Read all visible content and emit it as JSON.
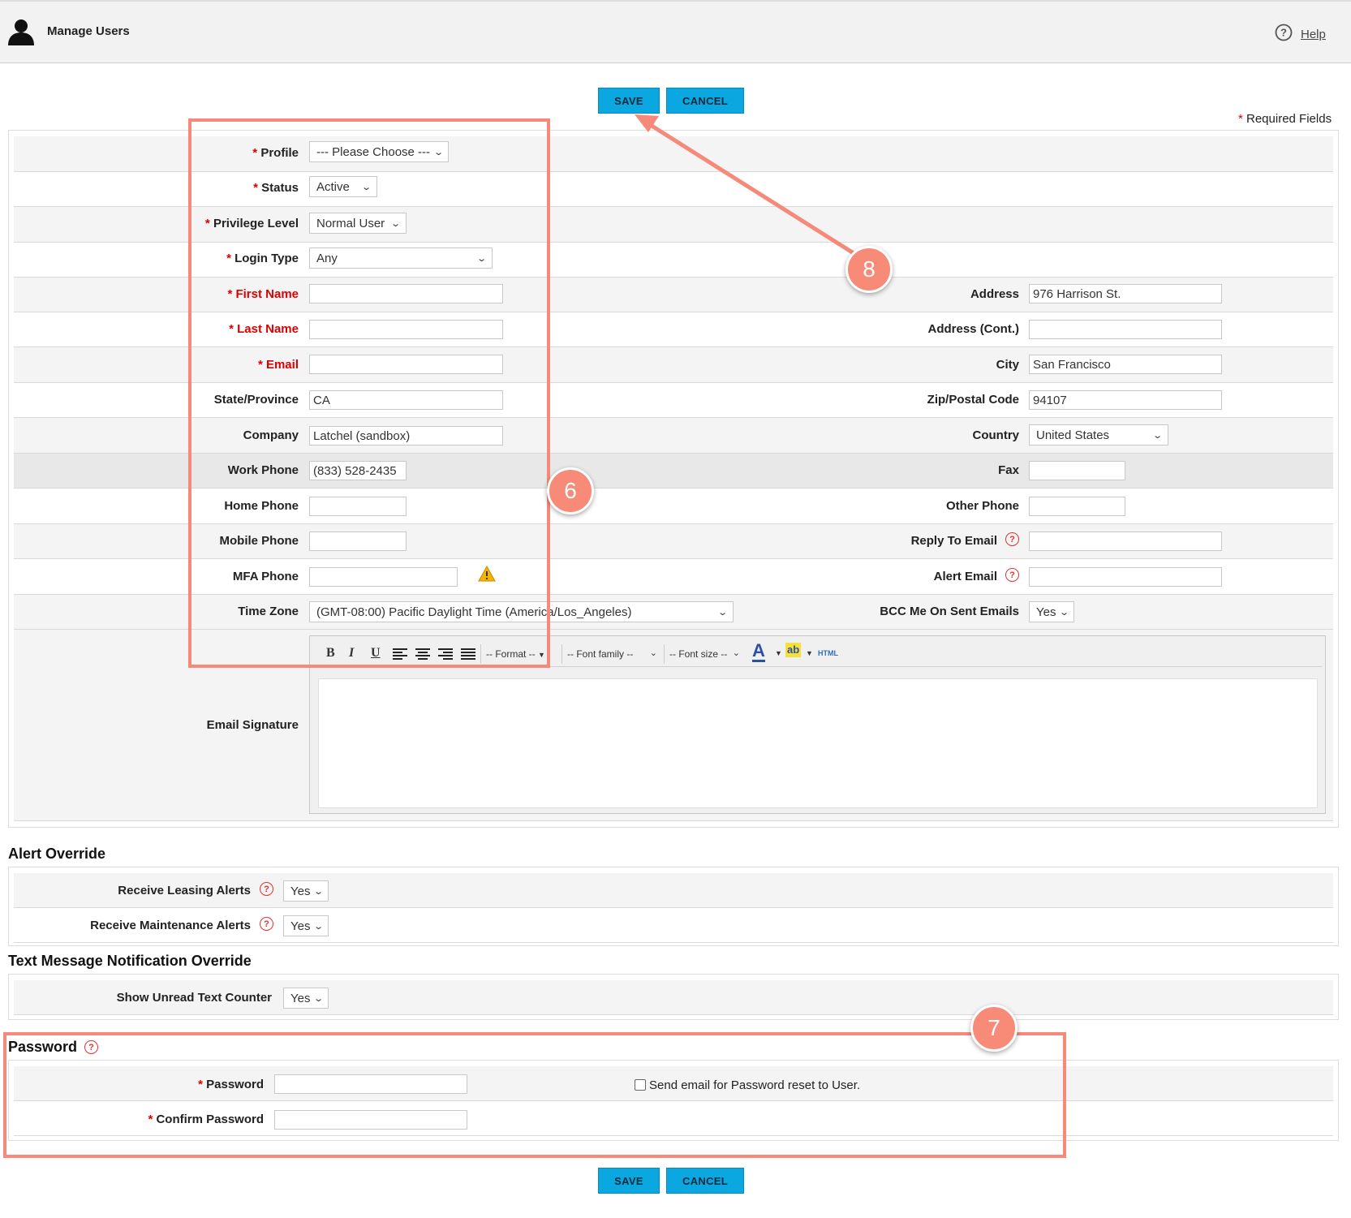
{
  "header": {
    "title": "Manage Users",
    "help": "Help"
  },
  "buttons": {
    "save": "SAVE",
    "cancel": "CANCEL"
  },
  "required_note": {
    "star": "*",
    "text": " Required Fields"
  },
  "form": {
    "profile": {
      "label": "Profile",
      "value": "--- Please Choose ---"
    },
    "status": {
      "label": "Status",
      "value": "Active"
    },
    "privilege": {
      "label": "Privilege Level",
      "value": "Normal User"
    },
    "login_type": {
      "label": "Login Type",
      "value": "Any"
    },
    "first_name": {
      "label": "First Name",
      "value": ""
    },
    "last_name": {
      "label": "Last Name",
      "value": ""
    },
    "email": {
      "label": "Email",
      "value": ""
    },
    "state": {
      "label": "State/Province",
      "value": "CA"
    },
    "company": {
      "label": "Company",
      "value": "Latchel (sandbox)"
    },
    "work_phone": {
      "label": "Work Phone",
      "value": "(833) 528-2435"
    },
    "home_phone": {
      "label": "Home Phone",
      "value": ""
    },
    "mobile_phone": {
      "label": "Mobile Phone",
      "value": ""
    },
    "mfa_phone": {
      "label": "MFA Phone",
      "value": ""
    },
    "time_zone": {
      "label": "Time Zone",
      "value": "(GMT-08:00) Pacific Daylight Time (America/Los_Angeles)"
    },
    "email_signature": {
      "label": "Email Signature"
    },
    "address": {
      "label": "Address",
      "value": "976 Harrison St."
    },
    "address2": {
      "label": "Address (Cont.)",
      "value": ""
    },
    "city": {
      "label": "City",
      "value": "San Francisco"
    },
    "zip": {
      "label": "Zip/Postal Code",
      "value": "94107"
    },
    "country": {
      "label": "Country",
      "value": "United States"
    },
    "fax": {
      "label": "Fax",
      "value": ""
    },
    "other_phone": {
      "label": "Other Phone",
      "value": ""
    },
    "reply_to": {
      "label": "Reply To Email",
      "value": ""
    },
    "alert_email": {
      "label": "Alert Email",
      "value": ""
    },
    "bcc": {
      "label": "BCC Me On Sent Emails",
      "value": "Yes"
    }
  },
  "editor_toolbar": {
    "bold": "B",
    "italic": "I",
    "underline": "U",
    "format": "-- Format --",
    "font_family": "-- Font family --",
    "font_size": "-- Font size --",
    "font_color": "A",
    "highlight": "ab",
    "html": "HTML"
  },
  "alert_override": {
    "title": "Alert Override",
    "leasing": {
      "label": "Receive Leasing Alerts",
      "value": "Yes"
    },
    "maintenance": {
      "label": "Receive Maintenance Alerts",
      "value": "Yes"
    }
  },
  "text_override": {
    "title": "Text Message Notification Override",
    "unread": {
      "label": "Show Unread Text Counter",
      "value": "Yes"
    }
  },
  "password": {
    "title": "Password",
    "password": {
      "label": "Password",
      "value": ""
    },
    "confirm": {
      "label": "Confirm Password",
      "value": ""
    },
    "send_reset": "Send email for Password reset to User."
  },
  "callouts": {
    "six": "6",
    "seven": "7",
    "eight": "8"
  },
  "colors": {
    "accent": "#0aa7e0",
    "callout": "#f88a78",
    "required": "#d00000"
  }
}
